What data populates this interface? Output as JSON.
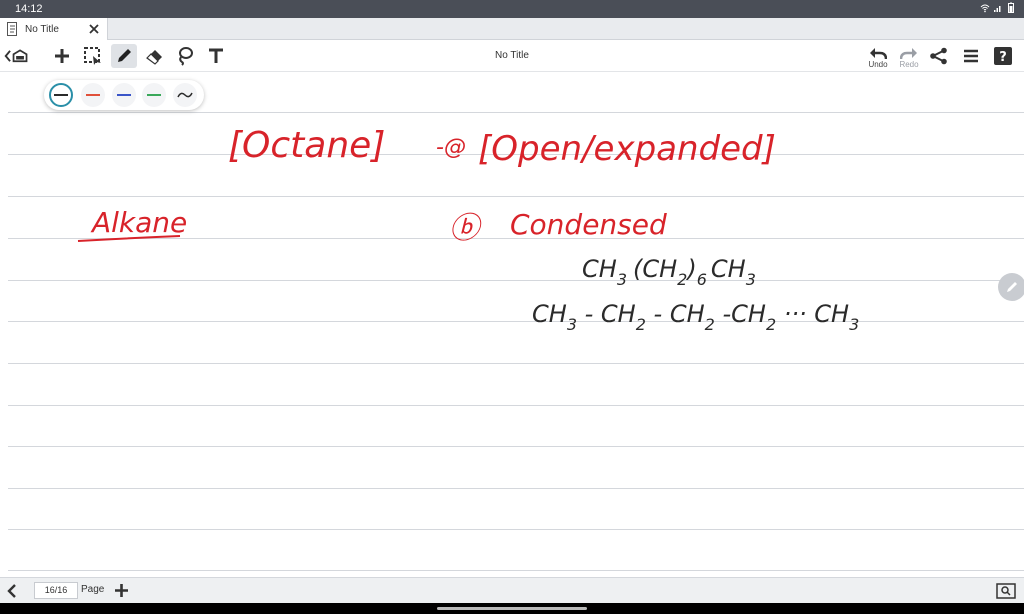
{
  "status_bar": {
    "time": "14:12"
  },
  "tab": {
    "title": "No Title"
  },
  "toolbar": {
    "doc_title": "No Title",
    "undo_label": "Undo",
    "redo_label": "Redo"
  },
  "palette": {
    "swatches": [
      {
        "name": "black",
        "color": "#2b2b2b",
        "selected": true
      },
      {
        "name": "red",
        "color": "#e0503a",
        "selected": false
      },
      {
        "name": "blue",
        "color": "#3a55c8",
        "selected": false
      },
      {
        "name": "green",
        "color": "#3aa85a",
        "selected": false
      },
      {
        "name": "pattern",
        "color": "#2b2b2b",
        "selected": false
      }
    ]
  },
  "notes": {
    "octane": "[Octane]",
    "option_a": "-@",
    "open_expanded": "[Open/expanded]",
    "alkane": "Alkane",
    "option_b": "ⓑ",
    "condensed": "Condensed",
    "formula_condensed": {
      "p1": "CH",
      "s1": "3",
      "p2": "(CH",
      "s2": "2",
      "p3": ")",
      "s3": "6",
      "p4": "CH",
      "s4": "3"
    },
    "formula_expanded": {
      "a": "CH",
      "as": "3",
      "b": " - CH",
      "bs": "2",
      "c": " - CH",
      "cs": "2",
      "d": " -CH",
      "ds": "2",
      "e": " ··· CH",
      "es": "3"
    },
    "ink_red": "#d8232a",
    "ink_black": "#2b2b2b"
  },
  "bottom_bar": {
    "page_count": "16/16",
    "page_label": "Page"
  }
}
